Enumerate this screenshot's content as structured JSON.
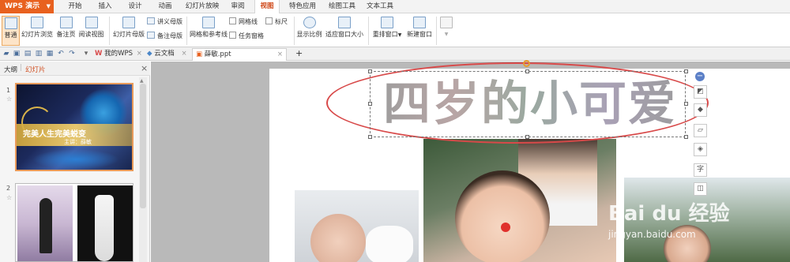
{
  "app": {
    "name": "WPS 演示"
  },
  "menu_tabs": [
    "开始",
    "插入",
    "设计",
    "动画",
    "幻灯片放映",
    "审阅",
    "视图",
    "特色应用",
    "绘图工具",
    "文本工具"
  ],
  "ribbon": {
    "normal": "普通",
    "slide_browse": "幻灯片浏览",
    "notes_page": "备注页",
    "reading_view": "阅读视图",
    "slide_master": "幻灯片母版",
    "handout_master": "讲义母版",
    "notes_master": "备注母版",
    "grid_guides": "网格和参考线",
    "gridlines": "网格线",
    "ruler": "标尺",
    "task_pane": "任务窗格",
    "zoom": "显示比例",
    "fit_window": "适应窗口大小",
    "arrange_window": "重排窗口",
    "new_window": "新建窗口"
  },
  "doc_tabs": {
    "my_wps": "我的WPS",
    "cloud_docs": "云文档",
    "current_file": "薛敏.ppt",
    "new_tab": "+"
  },
  "left_panel": {
    "tab_outline": "大纲",
    "tab_slides": "幻灯片",
    "close": "×",
    "slide1": {
      "num": "1",
      "title": "完美人生完美蜕变",
      "subtitle": "主讲：薛敏"
    },
    "slide2": {
      "num": "2"
    }
  },
  "slide": {
    "title": "四岁的小可爱"
  },
  "watermark": {
    "brand": "Bai du 经验",
    "url": "jingyan.baidu.com"
  },
  "colors": {
    "accent": "#e8611f",
    "active_tab": "#d04b1c",
    "ellipse": "#d84949"
  }
}
